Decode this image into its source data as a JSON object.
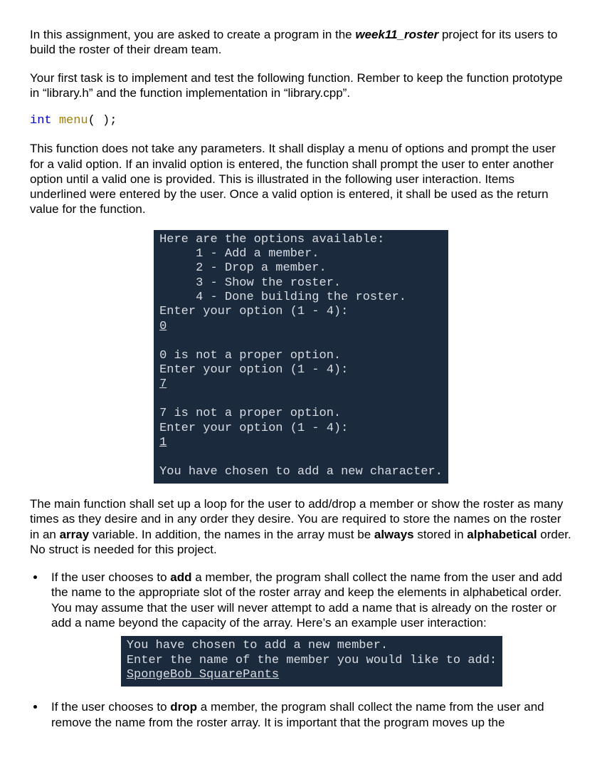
{
  "para1_a": "In this assignment, you are asked to create a program in the ",
  "para1_b": "week11_roster",
  "para1_c": " project for its users to build the roster of their dream team.",
  "para2": "Your first task is to implement and test the following function. Rember to keep the function prototype in “library.h” and the function implementation in “library.cpp”.",
  "code_kw": "int",
  "code_sp": " ",
  "code_fn": "menu",
  "code_tail": "( );",
  "para3": "This function does not take any parameters. It shall display a menu of options and prompt the user for a valid option. If an invalid option is entered, the function shall prompt the user to enter another option until a valid one is provided. This is illustrated in the following user interaction. Items underlined were entered by the user. Once a valid option is entered, it shall be used as the return value for the function.",
  "term1": {
    "l01": "Here are the options available:",
    "l02": "     1 - Add a member.",
    "l03": "     2 - Drop a member.",
    "l04": "     3 - Show the roster.",
    "l05": "     4 - Done building the roster.",
    "l06": "Enter your option (1 - 4):",
    "l07": "0",
    "l08": "",
    "l09": "0 is not a proper option.",
    "l10": "Enter your option (1 - 4):",
    "l11": "7",
    "l12": "",
    "l13": "7 is not a proper option.",
    "l14": "Enter your option (1 - 4):",
    "l15": "1",
    "l16": "",
    "l17": "You have chosen to add a new character."
  },
  "para4_a": "The main function shall set up a loop for the user to add/drop a member or show the roster as many times as they desire and in any order they desire. You are required to store the names on the roster in an ",
  "para4_b": "array",
  "para4_c": " variable. In addition, the names in the array must be ",
  "para4_d": "always",
  "para4_e": " stored in ",
  "para4_f": "alphabetical",
  "para4_g": " order. No struct is needed for this project.",
  "bullet1_a": "If the user chooses to ",
  "bullet1_b": "add",
  "bullet1_c": " a member, the program shall collect the name from the user and add the name to the appropriate slot of the roster array and keep the elements in alphabetical order. You may assume that the user will never attempt to add a name that is already on the roster or add a name beyond the capacity of the array. Here’s an example user interaction:",
  "term2": {
    "l1": "You have chosen to add a new member.",
    "l2": "Enter the name of the member you would like to add:",
    "l3": "SpongeBob SquarePants"
  },
  "bullet2_a": "If the user chooses to ",
  "bullet2_b": "drop",
  "bullet2_c": " a member, the program shall collect the name from the user and remove the name from the roster array. It is important that the program moves up the"
}
